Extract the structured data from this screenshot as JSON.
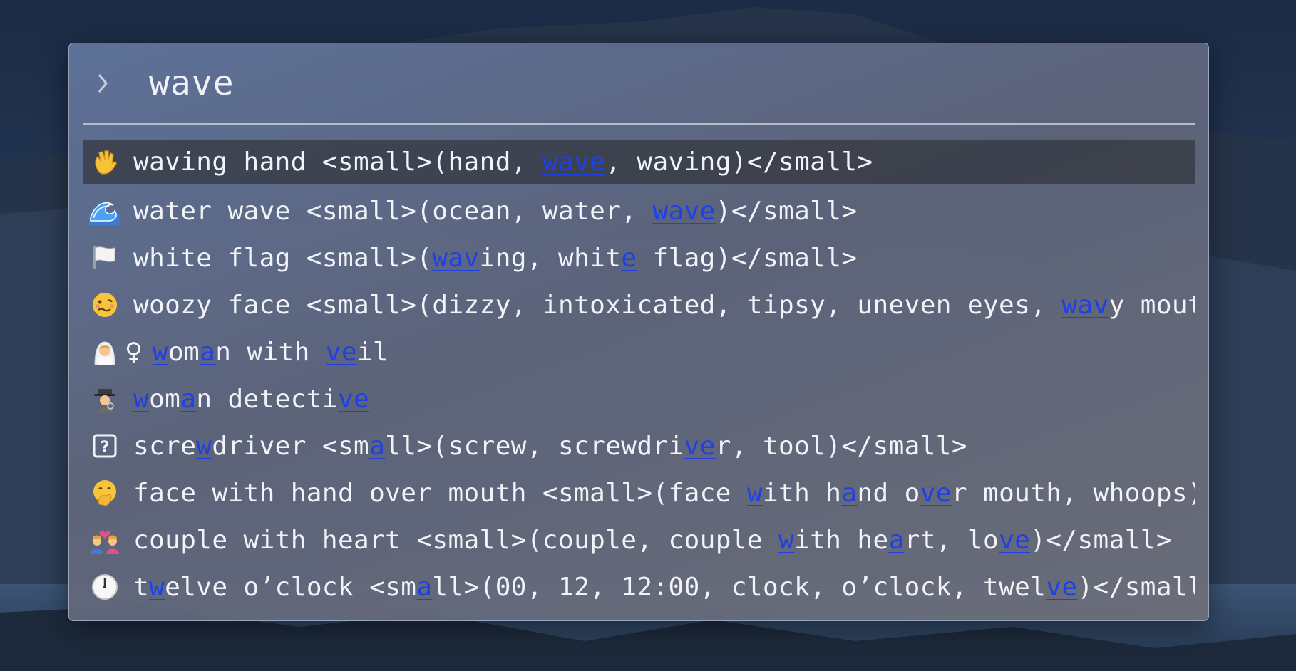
{
  "search": {
    "query": "wave"
  },
  "results": [
    {
      "emoji_icon": "waving-hand-icon",
      "selected": true,
      "segments": [
        {
          "t": "waving hand <small>(hand, "
        },
        {
          "t": "wave",
          "hl": true
        },
        {
          "t": ", waving)</small>"
        }
      ]
    },
    {
      "emoji_icon": "water-wave-icon",
      "segments": [
        {
          "t": "water wave <small>(ocean, water, "
        },
        {
          "t": "wave",
          "hl": true
        },
        {
          "t": ")</small>"
        }
      ]
    },
    {
      "emoji_icon": "white-flag-icon",
      "segments": [
        {
          "t": "white flag <small>("
        },
        {
          "t": "wav",
          "hl": true
        },
        {
          "t": "ing, whit"
        },
        {
          "t": "e",
          "hl": true
        },
        {
          "t": " flag)</small>"
        }
      ]
    },
    {
      "emoji_icon": "woozy-face-icon",
      "segments": [
        {
          "t": "woozy face <small>(dizzy, intoxicated, tipsy, uneven eyes, "
        },
        {
          "t": "wav",
          "hl": true
        },
        {
          "t": "y mouth)</small>"
        }
      ]
    },
    {
      "emoji_icon": "woman-with-veil-icon",
      "extra_symbol": "♀",
      "segments": [
        {
          "t": "w",
          "hl": true
        },
        {
          "t": "om"
        },
        {
          "t": "a",
          "hl": true
        },
        {
          "t": "n with "
        },
        {
          "t": "ve",
          "hl": true
        },
        {
          "t": "il"
        }
      ]
    },
    {
      "emoji_icon": "woman-detective-icon",
      "segments": [
        {
          "t": "w",
          "hl": true
        },
        {
          "t": "om"
        },
        {
          "t": "a",
          "hl": true
        },
        {
          "t": "n detecti"
        },
        {
          "t": "ve",
          "hl": true
        }
      ]
    },
    {
      "emoji_icon": "missing-glyph-icon",
      "segments": [
        {
          "t": "scre"
        },
        {
          "t": "w",
          "hl": true
        },
        {
          "t": "driver <sm"
        },
        {
          "t": "a",
          "hl": true
        },
        {
          "t": "ll>(screw, screwdri"
        },
        {
          "t": "ve",
          "hl": true
        },
        {
          "t": "r, tool)</small>"
        }
      ]
    },
    {
      "emoji_icon": "face-with-hand-over-mouth-icon",
      "segments": [
        {
          "t": "face with hand over mouth <small>(face "
        },
        {
          "t": "w",
          "hl": true
        },
        {
          "t": "ith h"
        },
        {
          "t": "a",
          "hl": true
        },
        {
          "t": "nd o"
        },
        {
          "t": "ve",
          "hl": true
        },
        {
          "t": "r mouth, whoops)</small>"
        }
      ]
    },
    {
      "emoji_icon": "couple-with-heart-icon",
      "segments": [
        {
          "t": "couple with heart <small>(couple, couple "
        },
        {
          "t": "w",
          "hl": true
        },
        {
          "t": "ith he"
        },
        {
          "t": "a",
          "hl": true
        },
        {
          "t": "rt, lo"
        },
        {
          "t": "ve",
          "hl": true
        },
        {
          "t": ")</small>"
        }
      ]
    },
    {
      "emoji_icon": "twelve-oclock-icon",
      "segments": [
        {
          "t": "t"
        },
        {
          "t": "w",
          "hl": true
        },
        {
          "t": "elve o’clock <sm"
        },
        {
          "t": "a",
          "hl": true
        },
        {
          "t": "ll>(00, 12, 12:00, clock, o’clock, twel"
        },
        {
          "t": "ve",
          "hl": true
        },
        {
          "t": ")</small>"
        }
      ]
    }
  ],
  "colors": {
    "highlight": "#1f3fe8",
    "text": "#f1f3f8",
    "selected_row": "#32353c"
  }
}
